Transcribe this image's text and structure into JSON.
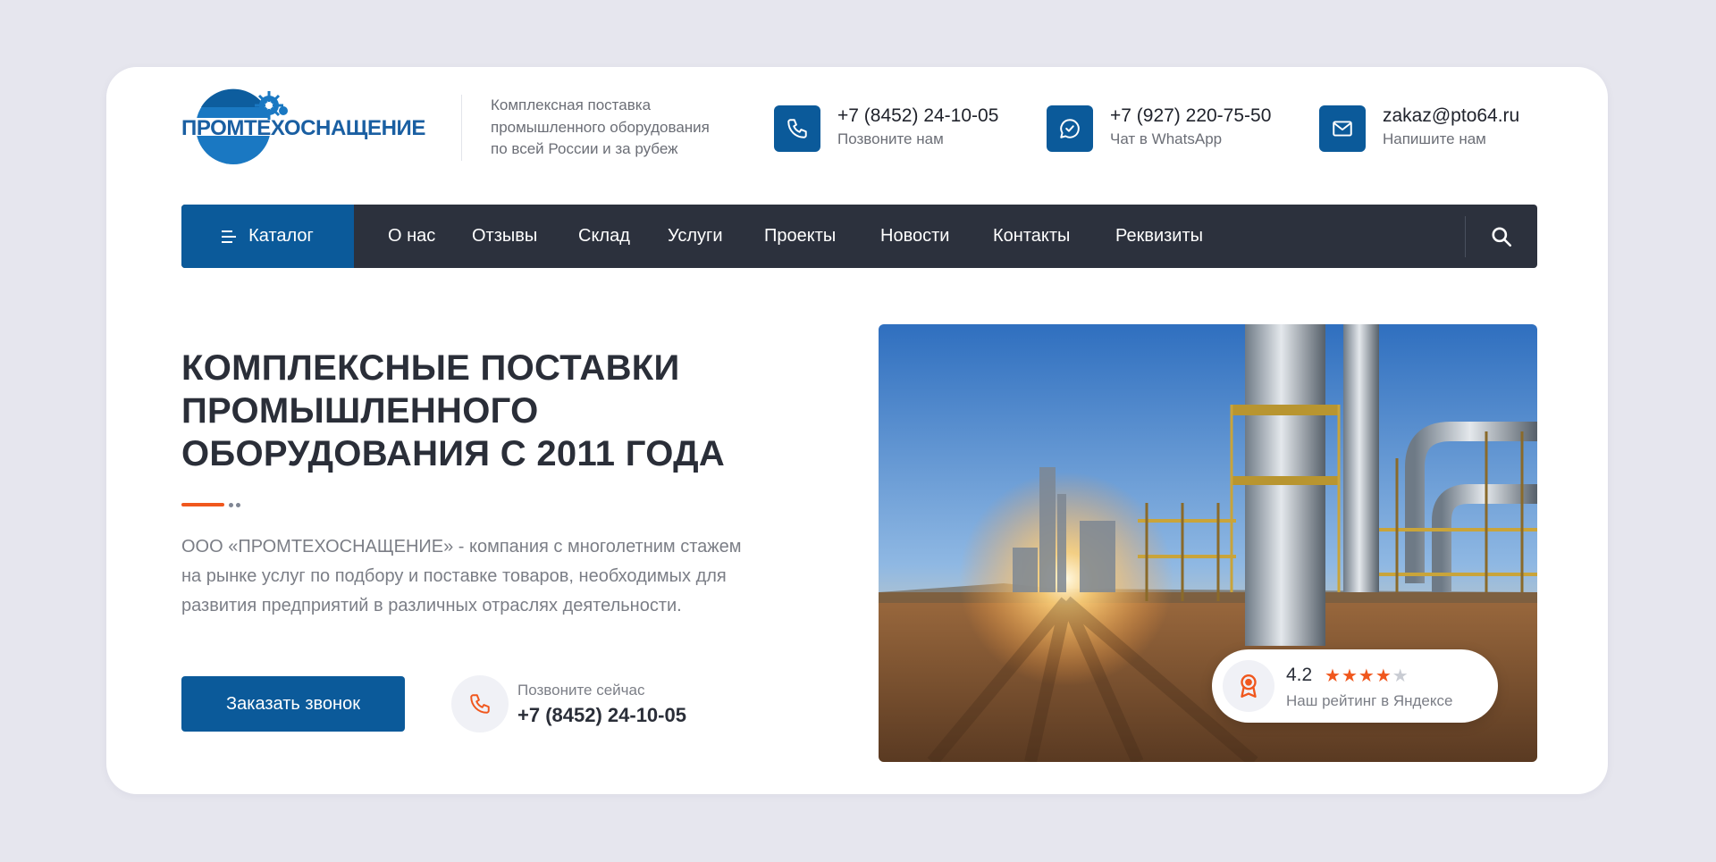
{
  "header": {
    "logo_text": "ПРОМТЕХОСНАЩЕНИЕ",
    "tagline": [
      "Комплексная поставка",
      "промышленного оборудования",
      "по всей России и за рубеж"
    ],
    "contacts": [
      {
        "icon": "phone-icon",
        "main": "+7 (8452) 24-10-05",
        "sub": "Позвоните нам"
      },
      {
        "icon": "whatsapp-icon",
        "main": "+7 (927) 220-75-50",
        "sub": "Чат в WhatsApp"
      },
      {
        "icon": "mail-icon",
        "main": "zakaz@pto64.ru",
        "sub": "Напишите нам"
      }
    ]
  },
  "nav": {
    "catalog_label": "Каталог",
    "items": [
      "О нас",
      "Отзывы",
      "Склад",
      "Услуги",
      "Проекты",
      "Новости",
      "Контакты",
      "Реквизиты"
    ]
  },
  "hero": {
    "title_lines": [
      "КОМПЛЕКСНЫЕ ПОСТАВКИ",
      "ПРОМЫШЛЕННОГО",
      "ОБОРУДОВАНИЯ С 2011 ГОДА"
    ],
    "description_lines": [
      "ООО «ПРОМТЕХОСНАЩЕНИЕ» - компания с многолетним стажем",
      "на рынке услуг по подбору и поставке товаров, необходимых для",
      "развития предприятий в различных отраслях деятельности."
    ],
    "cta_label": "Заказать звонок",
    "call_sub": "Позвоните сейчас",
    "call_phone": "+7 (8452) 24-10-05"
  },
  "rating": {
    "value": "4.2",
    "stars_filled": 4,
    "stars_total": 5,
    "label": "Наш рейтинг в Яндексе"
  },
  "colors": {
    "brand_blue": "#0b5a9a",
    "nav_dark": "#2c313d",
    "accent_orange": "#f0571d",
    "page_bg": "#e6e6ee"
  }
}
